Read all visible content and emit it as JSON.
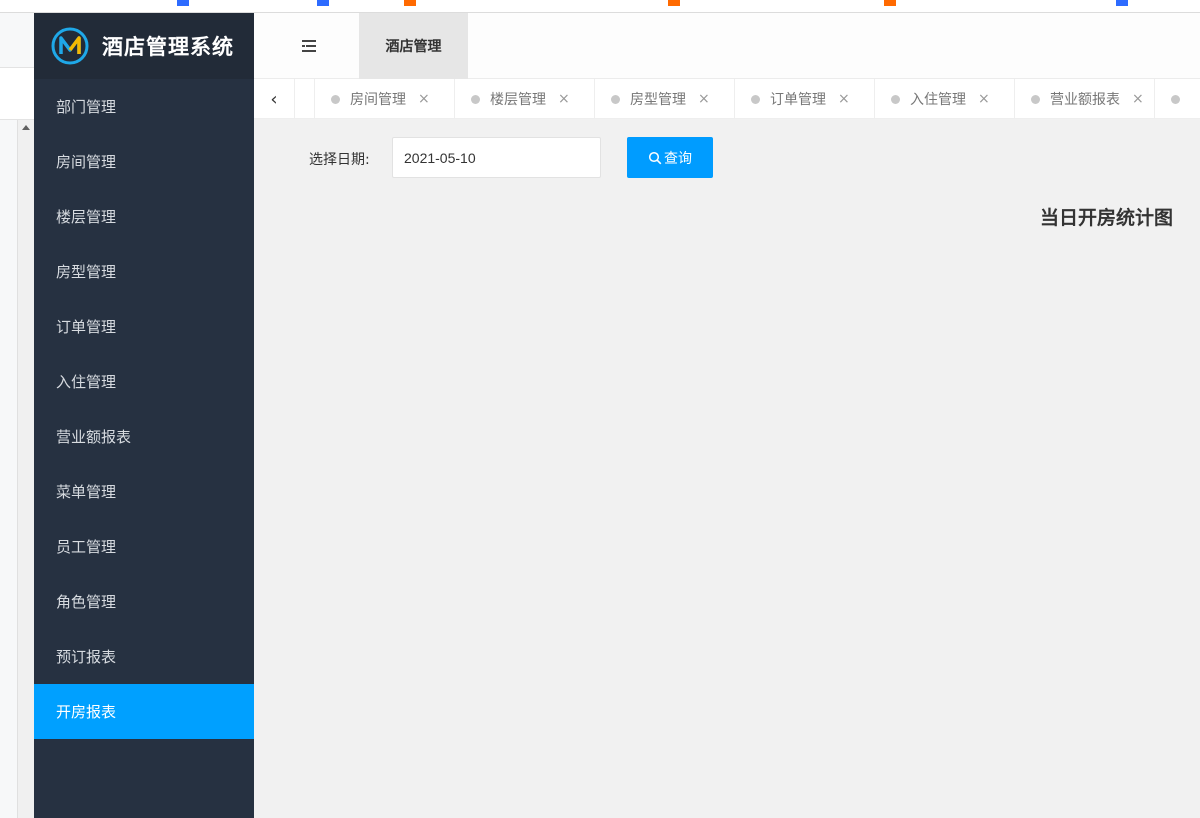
{
  "app": {
    "title": "酒店管理系统"
  },
  "header": {
    "top_tab": "酒店管理"
  },
  "sidebar": {
    "items": [
      {
        "label": "部门管理"
      },
      {
        "label": "房间管理"
      },
      {
        "label": "楼层管理"
      },
      {
        "label": "房型管理"
      },
      {
        "label": "订单管理"
      },
      {
        "label": "入住管理"
      },
      {
        "label": "营业额报表"
      },
      {
        "label": "菜单管理"
      },
      {
        "label": "员工管理"
      },
      {
        "label": "角色管理"
      },
      {
        "label": "预订报表"
      },
      {
        "label": "开房报表"
      }
    ],
    "active_index": 11
  },
  "tabs": {
    "prev_icon": "‹",
    "close_icon": "×",
    "items": [
      {
        "label": "房间管理"
      },
      {
        "label": "楼层管理"
      },
      {
        "label": "房型管理"
      },
      {
        "label": "订单管理"
      },
      {
        "label": "入住管理"
      },
      {
        "label": "营业额报表"
      }
    ]
  },
  "filter": {
    "date_label": "选择日期:",
    "date_value": "2021-05-10",
    "query_label": "查询"
  },
  "chart": {
    "title": "当日开房统计图"
  },
  "colors": {
    "sidebar_bg": "#263141",
    "logo_bg": "#222b38",
    "accent": "#00a0ff",
    "button": "#009cff",
    "content_bg": "#f1f1f1"
  }
}
